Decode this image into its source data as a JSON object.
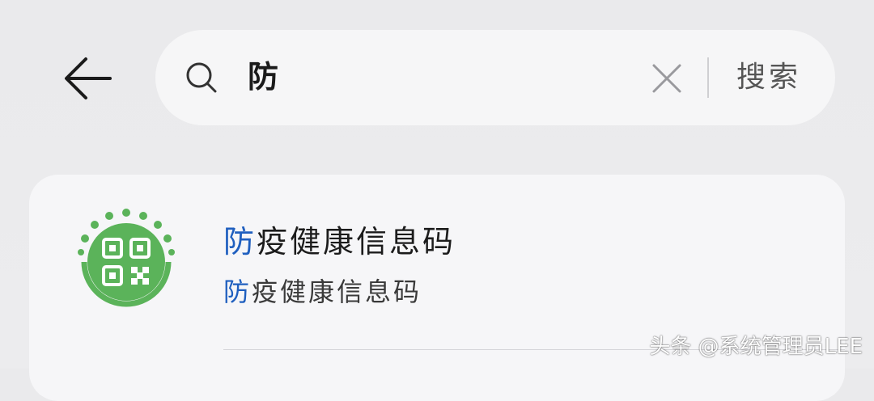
{
  "header": {
    "back_icon": "arrow-left-icon",
    "search": {
      "icon": "search-icon",
      "query": "防",
      "clear_icon": "close-icon",
      "search_label": "搜索"
    }
  },
  "results": [
    {
      "icon": "qr-code-app-icon",
      "title_highlight": "防",
      "title_rest": "疫健康信息码",
      "subtitle_highlight": "防",
      "subtitle_rest": "疫健康信息码"
    }
  ],
  "watermark": "头条 @系统管理员LEE",
  "colors": {
    "highlight": "#1f5fbf",
    "icon_green": "#5bb35a",
    "background": "#ebebed",
    "card": "#f6f6f8"
  }
}
